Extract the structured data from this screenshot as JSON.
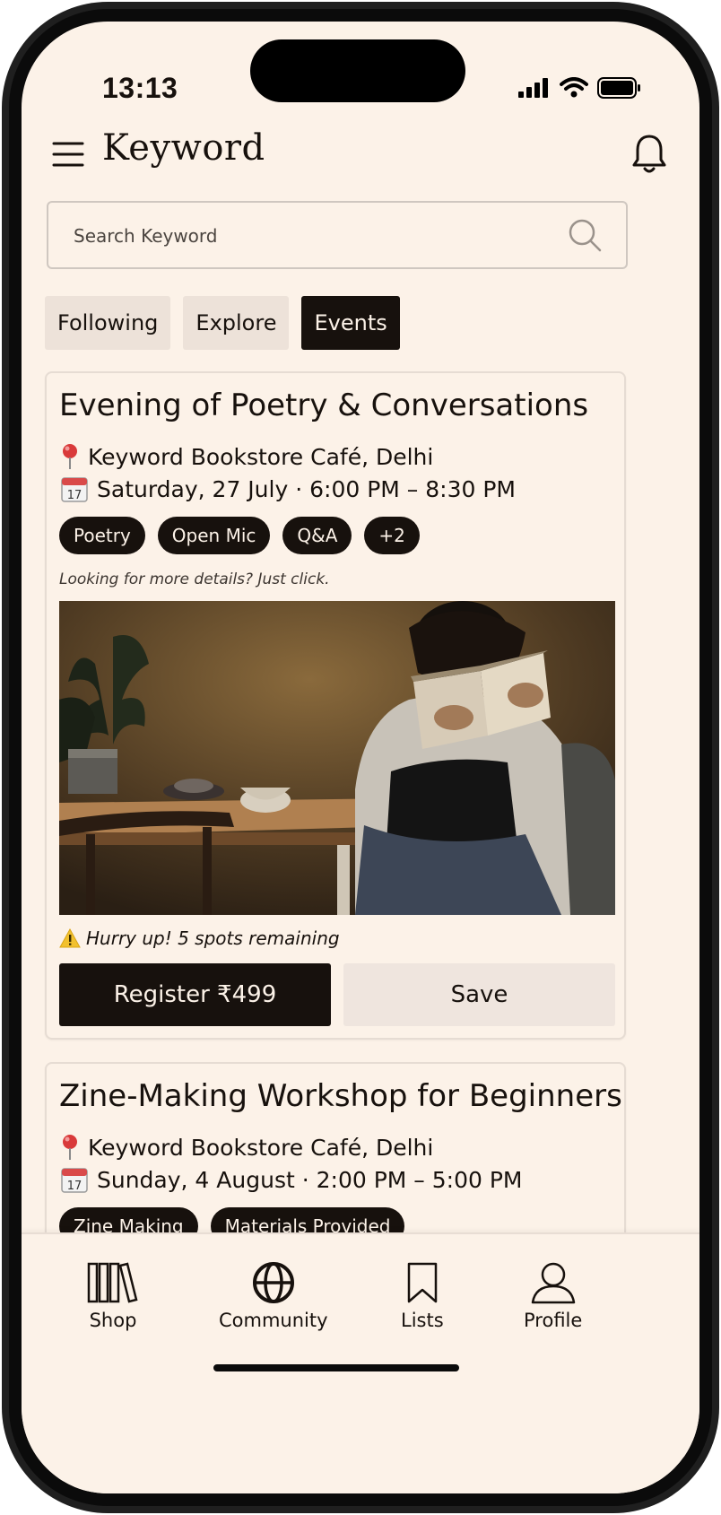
{
  "status_bar": {
    "time": "13:13"
  },
  "header": {
    "brand": "Keyword"
  },
  "search": {
    "placeholder": "Search Keyword"
  },
  "tabs": [
    {
      "label": "Following",
      "active": false
    },
    {
      "label": "Explore",
      "active": false
    },
    {
      "label": "Events",
      "active": true
    }
  ],
  "events": [
    {
      "title": "Evening of Poetry & Conversations",
      "location": "Keyword Bookstore Café, Delhi",
      "datetime": "Saturday, 27 July · 6:00 PM – 8:30 PM",
      "tags": [
        "Poetry",
        "Open Mic",
        "Q&A",
        "+2"
      ],
      "hint": "Looking for more details? Just click.",
      "alert": "Hurry up! 5 spots remaining",
      "register_label": "Register ₹499",
      "save_label": "Save"
    },
    {
      "title": "Zine-Making Workshop for Beginners",
      "location": "Keyword Bookstore Café, Delhi",
      "datetime": "Sunday, 4 August · 2:00 PM – 5:00 PM",
      "tags": [
        "Zine Making",
        "Materials Provided"
      ]
    }
  ],
  "bottom_nav": [
    {
      "label": "Shop",
      "icon": "books-icon"
    },
    {
      "label": "Community",
      "icon": "globe-icon",
      "active": true
    },
    {
      "label": "Lists",
      "icon": "bookmark-icon"
    },
    {
      "label": "Profile",
      "icon": "user-icon"
    }
  ],
  "colors": {
    "background": "#fcf2e8",
    "ink": "#17110d",
    "muted_chip": "#ede2d9"
  }
}
